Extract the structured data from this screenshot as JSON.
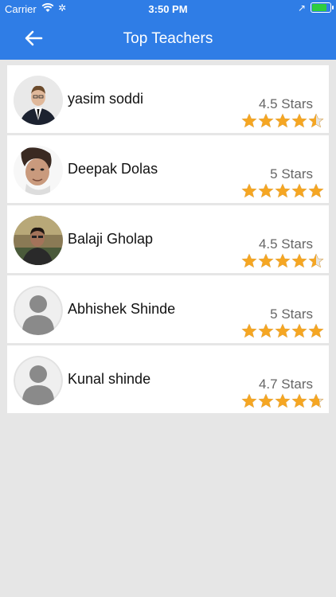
{
  "status_bar": {
    "carrier": "Carrier",
    "time": "3:50 PM"
  },
  "header": {
    "title": "Top Teachers"
  },
  "colors": {
    "nav": "#2f7de6",
    "star": "#f5a623",
    "star_empty": "#e5e5e5",
    "background": "#e6e6e6"
  },
  "teachers": [
    {
      "name": "yasim soddi",
      "rating_text": "4.5 Stars",
      "rating": 4.5,
      "avatar": "photo-suit"
    },
    {
      "name": "Deepak Dolas",
      "rating_text": "5 Stars",
      "rating": 5,
      "avatar": "photo-man"
    },
    {
      "name": "Balaji Gholap",
      "rating_text": "4.5 Stars",
      "rating": 4.5,
      "avatar": "photo-outdoor"
    },
    {
      "name": "Abhishek Shinde",
      "rating_text": "5 Stars",
      "rating": 5,
      "avatar": "placeholder"
    },
    {
      "name": "Kunal shinde",
      "rating_text": "4.7 Stars",
      "rating": 4.7,
      "avatar": "placeholder"
    }
  ]
}
